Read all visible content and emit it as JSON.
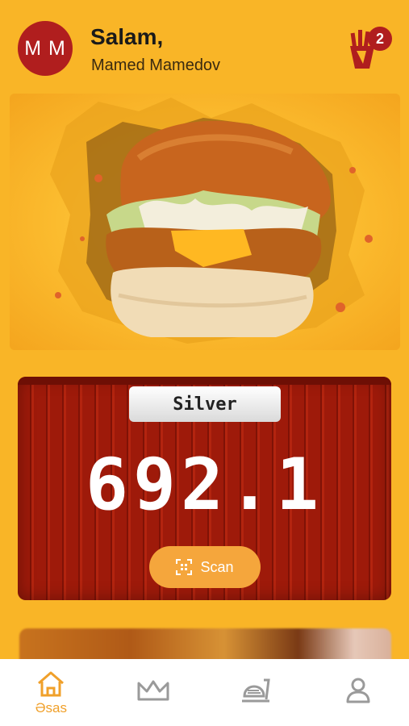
{
  "header": {
    "avatar_initials": "M M",
    "greeting": "Salam,",
    "user_name": "Mamed Mamedov",
    "cart_count": "2"
  },
  "banner": {
    "image": "chicken-burger-promo"
  },
  "loyalty_card": {
    "tier": "Silver",
    "points": "692.1",
    "scan_label": "Scan"
  },
  "bottom_nav": {
    "items": [
      {
        "label": "Əsas",
        "icon": "home-icon",
        "active": true
      },
      {
        "label": "",
        "icon": "crown-icon",
        "active": false
      },
      {
        "label": "",
        "icon": "food-tray-icon",
        "active": false
      },
      {
        "label": "",
        "icon": "profile-icon",
        "active": false
      }
    ]
  },
  "colors": {
    "background": "#F9B527",
    "brand_red": "#B01E1E",
    "active_nav": "#F0A02A",
    "inactive_nav": "#9A9A9A"
  }
}
